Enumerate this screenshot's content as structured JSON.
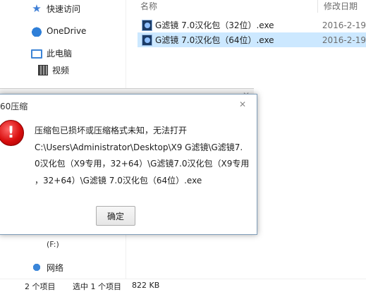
{
  "nav": {
    "items": [
      {
        "label": "快速访问",
        "icon": "star-icon"
      },
      {
        "label": "OneDrive",
        "icon": "cloud-icon"
      },
      {
        "label": "此电脑",
        "icon": "pc-icon"
      },
      {
        "label": "视频",
        "icon": "video-icon"
      },
      {
        "label": "网络",
        "icon": "network-icon"
      }
    ],
    "drive_label": "(F:)"
  },
  "columns": {
    "name": "名称",
    "modified": "修改日期"
  },
  "files": [
    {
      "name": "G滤镜 7.0汉化包（32位）.exe",
      "date": "2016-2-19"
    },
    {
      "name": "G滤镜 7.0汉化包（64位）.exe",
      "date": "2016-2-19"
    }
  ],
  "status": {
    "count": "2 个项目",
    "selected": "选中 1 个项目",
    "size": "822 KB"
  },
  "dialog": {
    "title": "60压缩",
    "close_icon": "close-icon",
    "message_lines": [
      "压缩包已损坏或压缩格式未知，无法打开",
      "C:\\Users\\Administrator\\Desktop\\X9 G滤镜\\G滤镜7.",
      "0汉化包（X9专用，32+64）\\G滤镜7.0汉化包（X9专用",
      "，32+64）\\G滤镜 7.0汉化包（64位）.exe"
    ],
    "ok_label": "确定"
  }
}
